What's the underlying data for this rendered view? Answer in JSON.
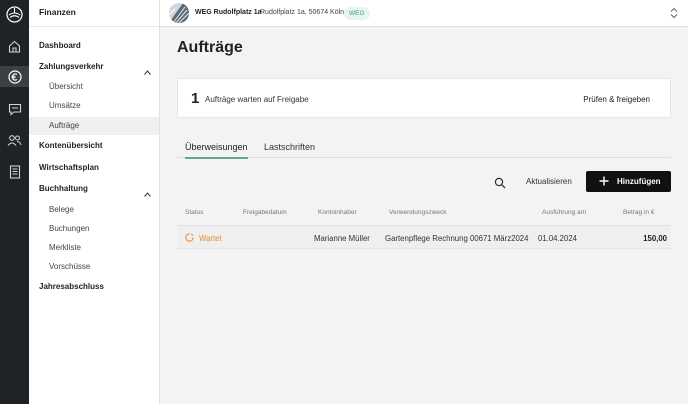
{
  "colors": {
    "accent": "#5fa98f",
    "warning": "#e88a33",
    "rail": "#1f2326",
    "primary_button": "#111111"
  },
  "rail": {
    "icons": [
      "logo-icon",
      "home-icon",
      "euro-icon",
      "chat-icon",
      "people-icon",
      "document-icon"
    ],
    "active": "euro-icon"
  },
  "sidebar": {
    "title": "Finanzen",
    "items": [
      {
        "label": "Dashboard",
        "level": "top"
      },
      {
        "label": "Zahlungsverkehr",
        "level": "top",
        "expanded": true
      },
      {
        "label": "Übersicht",
        "level": "sub"
      },
      {
        "label": "Umsätze",
        "level": "sub"
      },
      {
        "label": "Aufträge",
        "level": "sub",
        "selected": true
      },
      {
        "label": "Kontenübersicht",
        "level": "top"
      },
      {
        "label": "Wirtschaftsplan",
        "level": "top"
      },
      {
        "label": "Buchhaltung",
        "level": "top",
        "expanded": true
      },
      {
        "label": "Belege",
        "level": "sub"
      },
      {
        "label": "Buchungen",
        "level": "sub"
      },
      {
        "label": "Merkliste",
        "level": "sub"
      },
      {
        "label": "Vorschüsse",
        "level": "sub"
      },
      {
        "label": "Jahresabschluss",
        "level": "top"
      }
    ]
  },
  "topbar": {
    "property_name": "WEG Rudolfplatz 1a",
    "property_address": "Rudolfplatz 1a, 50674 Köln",
    "badge": "WEG"
  },
  "main": {
    "title": "Aufträge",
    "approval": {
      "count": "1",
      "message": "Aufträge warten auf Freigabe",
      "action": "Prüfen & freigeben"
    },
    "tabs": [
      {
        "label": "Überweisungen",
        "active": true
      },
      {
        "label": "Lastschriften",
        "active": false
      }
    ],
    "toolbar": {
      "refresh_label": "Aktualisieren",
      "add_label": "Hinzufügen"
    },
    "table": {
      "columns": [
        "Status",
        "Freigabedatum",
        "Kontoinhaber",
        "Verwendungszweck",
        "Ausführung am",
        "Betrag in €"
      ],
      "rows": [
        {
          "status": "Wartet",
          "freigabedatum": "",
          "kontoinhaber": "Marianne Müller",
          "verwendungszweck": "Gartenpflege Rechnung 00671 März2024",
          "ausfuehrung": "01.04.2024",
          "betrag": "150,00"
        }
      ]
    }
  }
}
